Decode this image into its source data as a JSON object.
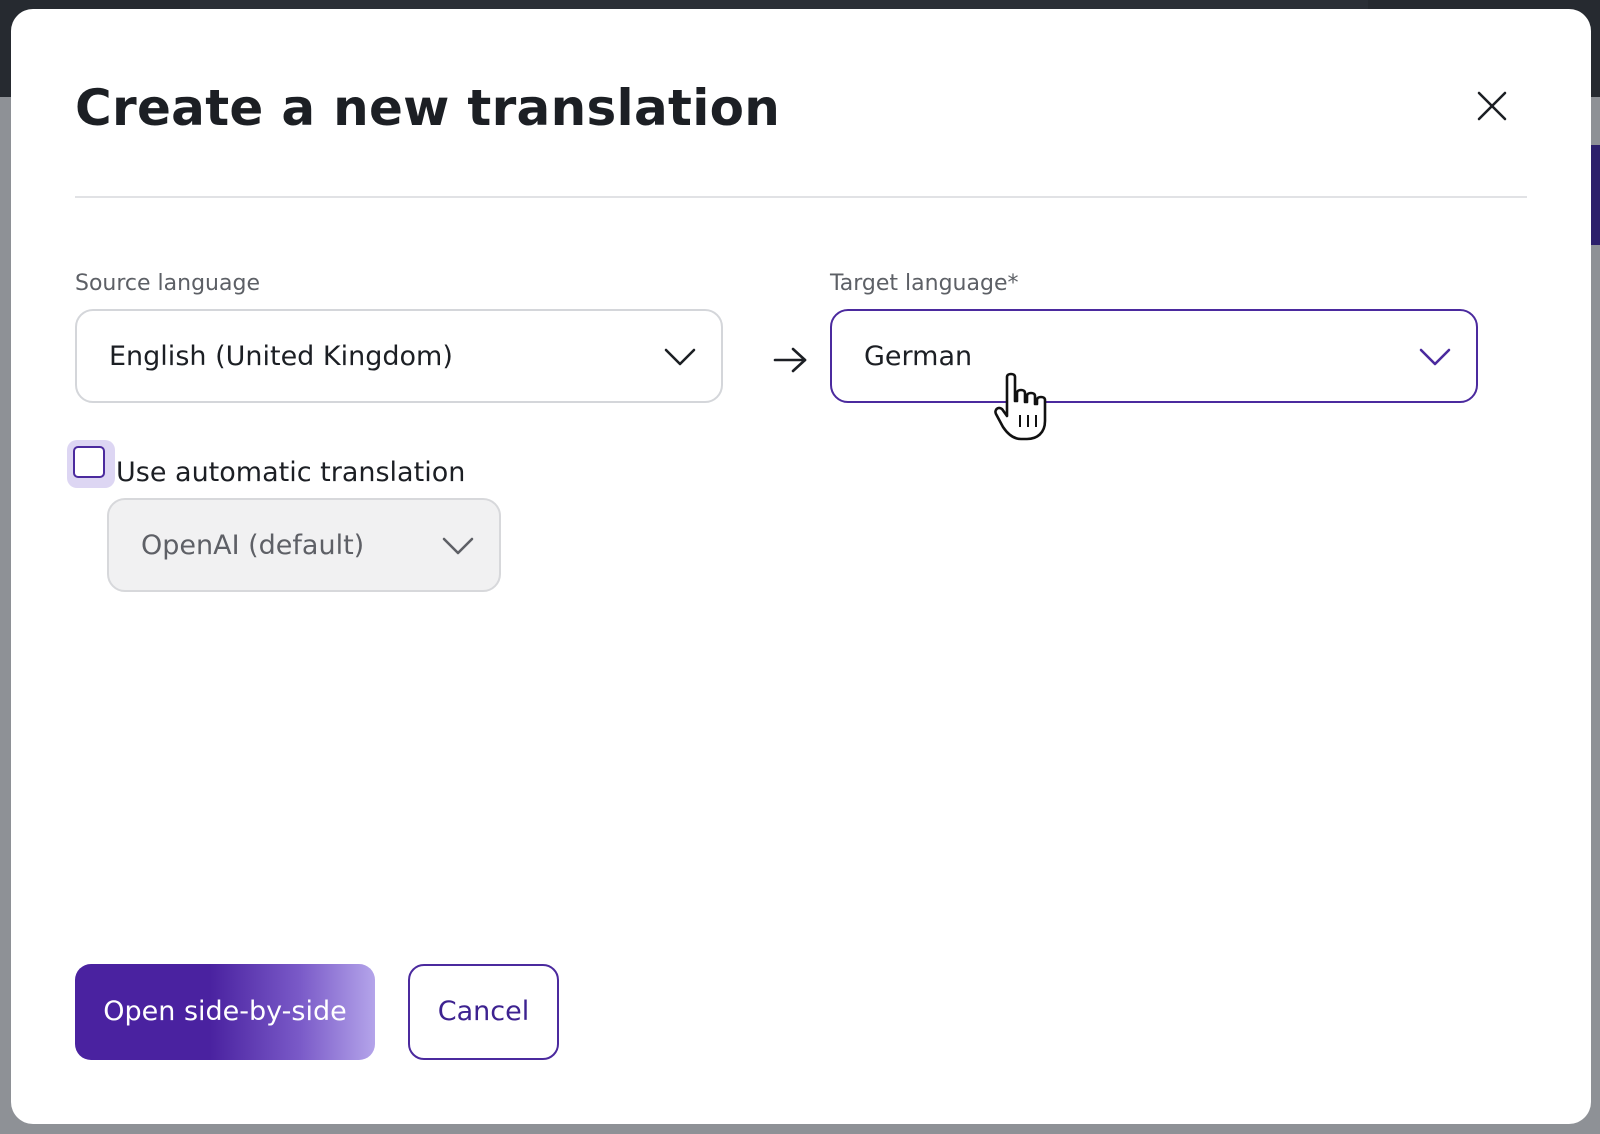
{
  "modal": {
    "title": "Create a new translation",
    "close_icon": "close-icon"
  },
  "source_language": {
    "label": "Source language",
    "value": "English (United Kingdom)",
    "icon": "chevron-down-icon"
  },
  "direction_icon": "arrow-right-icon",
  "target_language": {
    "label": "Target language*",
    "value": "German",
    "icon": "chevron-down-icon"
  },
  "automatic_translation": {
    "label": "Use automatic translation",
    "checked": false,
    "engine": {
      "value": "OpenAI (default)",
      "disabled": true
    }
  },
  "actions": {
    "primary_label": "Open side-by-side",
    "secondary_label": "Cancel"
  },
  "colors": {
    "accent": "#4b2a9e",
    "title_text": "#1c1f24",
    "label_text": "#5d6066",
    "backdrop": "#8e9196"
  }
}
